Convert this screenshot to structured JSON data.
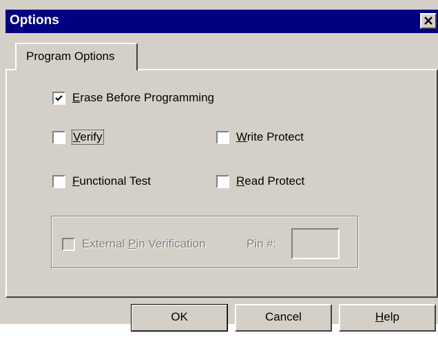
{
  "window": {
    "title": "Options",
    "close_glyph": "✕"
  },
  "tabs": [
    {
      "label": "Program Options"
    }
  ],
  "options": {
    "erase_before_programming": {
      "label": "Erase Before Programming",
      "mnemonic": "E",
      "rest": "rase Before Programming",
      "checked": true
    },
    "verify": {
      "label": "Verify",
      "mnemonic": "V",
      "rest": "erify",
      "checked": false
    },
    "write_protect": {
      "label": "Write Protect",
      "mnemonic": "W",
      "rest": "rite Protect",
      "checked": false
    },
    "functional_test": {
      "label": "Functional Test",
      "mnemonic": "F",
      "rest": "unctional Test",
      "checked": false
    },
    "read_protect": {
      "label": "Read Protect",
      "mnemonic": "R",
      "rest": "ead Protect",
      "checked": false
    }
  },
  "external_pin": {
    "label": "External Pin Verification",
    "before": "External ",
    "mnemonic": "P",
    "after": "in Verification",
    "checked": false,
    "enabled": false,
    "pin_label": "Pin #:",
    "pin_value": ""
  },
  "buttons": {
    "ok": "OK",
    "cancel": "Cancel",
    "help_mnemonic": "H",
    "help_rest": "elp",
    "help": "Help"
  }
}
